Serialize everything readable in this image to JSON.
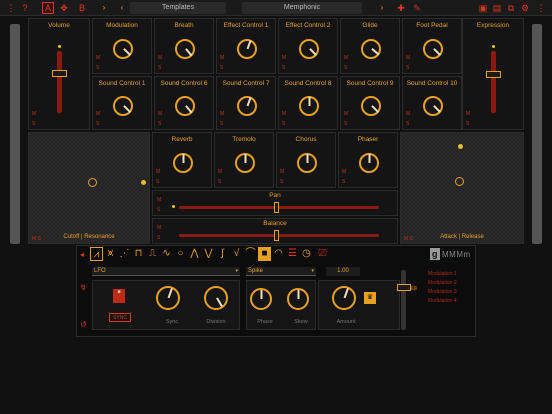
{
  "topbar": {
    "help_icon": "?",
    "mode_a": "A",
    "mode_b": "B",
    "prev_arrow": "‹",
    "template_field": "Templates",
    "preset_field": "Memphonic",
    "next_arrow": "›",
    "menu_icon": "⋮"
  },
  "sliders": {
    "volume": {
      "label": "Volume",
      "value": 0.8
    },
    "expression": {
      "label": "Expression",
      "value": 0.78
    }
  },
  "knobs_row1": [
    {
      "label": "Modulation"
    },
    {
      "label": "Breath"
    },
    {
      "label": "Effect Control 1"
    },
    {
      "label": "Effect Control 2"
    },
    {
      "label": "Glide"
    },
    {
      "label": "Foot Pedal"
    }
  ],
  "knobs_row2": [
    {
      "label": "Sound Control 1"
    },
    {
      "label": "Sound Control 6"
    },
    {
      "label": "Sound Control 7"
    },
    {
      "label": "Sound Control 8"
    },
    {
      "label": "Sound Control 9"
    },
    {
      "label": "Sound Control 10"
    }
  ],
  "knobs_row3": [
    {
      "label": "Reverb"
    },
    {
      "label": "Tremolo"
    },
    {
      "label": "Chorus"
    },
    {
      "label": "Phaser"
    }
  ],
  "xy_pads": {
    "left": {
      "label": "Cutoff | Resonance"
    },
    "right": {
      "label": "Attack | Release"
    }
  },
  "hsliders": {
    "pan": {
      "label": "Pan",
      "value": 0.5
    },
    "balance": {
      "label": "Balance",
      "value": 0.5
    }
  },
  "lfo": {
    "brand": "MMMm",
    "source_select": "LFO",
    "shape_select": "Spike",
    "rate_value": "1.00",
    "knobs": [
      {
        "label": "Sync"
      },
      {
        "label": "Division"
      },
      {
        "label": "Phase"
      },
      {
        "label": "Skew"
      },
      {
        "label": "Amount"
      }
    ],
    "sync_button": "SYNC",
    "list": [
      "Modulation 1",
      "Modulation 2",
      "Modulation 3",
      "Modulation 4"
    ]
  },
  "colors": {
    "accent": "#e8a020",
    "red": "#e0341e",
    "background": "#111111"
  }
}
